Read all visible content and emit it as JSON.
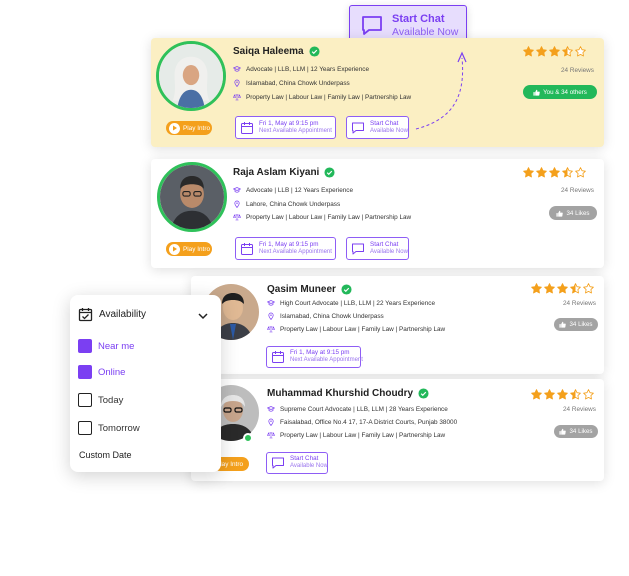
{
  "chat_callout": {
    "title": "Start Chat",
    "subtitle": "Available Now"
  },
  "lawyers": [
    {
      "name": "Saiqa Haleema",
      "qualification": "Advocate | LLB, LLM | 12 Years Experience",
      "location": "Islamabad, China Chowk Underpass",
      "practice_areas": "Property Law | Labour Law | Family Law | Partnership Law",
      "rating": 3.5,
      "reviews": "24 Reviews",
      "likes": "You & 34 others",
      "play_label": "Play Intro",
      "appointment_title": "Fri 1, May at 9:15 pm",
      "appointment_sub": "Next Available Appointment",
      "chat_title": "Start Chat",
      "chat_sub": "Available Now"
    },
    {
      "name": "Raja Aslam Kiyani",
      "qualification": "Advocate | LLB | 12 Years Experience",
      "location": "Lahore, China Chowk Underpass",
      "practice_areas": "Property Law | Labour Law | Family Law | Partnership Law",
      "rating": 3.5,
      "reviews": "24 Reviews",
      "likes": "34 Likes",
      "play_label": "Play Intro",
      "appointment_title": "Fri 1, May at 9:15 pm",
      "appointment_sub": "Next Available Appointment",
      "chat_title": "Start Chat",
      "chat_sub": "Available Now"
    },
    {
      "name": "Qasim Muneer",
      "qualification": "High Court Advocate | LLB, LLM | 22 Years Experience",
      "location": "Islamabad, China Chowk Underpass",
      "practice_areas": "Property Law | Labour Law | Family Law | Partnership Law",
      "rating": 3.5,
      "reviews": "24 Reviews",
      "likes": "34 Likes",
      "appointment_title": "Fri 1, May at 9:15 pm",
      "appointment_sub": "Next Available Appointment"
    },
    {
      "name": "Muhammad Khurshid Choudry",
      "qualification": "Supreme Court Advocate | LLB, LLM | 28 Years Experience",
      "location": "Faisalabad, Office No.4 17, 17-A District Courts, Punjab 38000",
      "practice_areas": "Property Law | Labour Law | Family Law | Partnership Law",
      "rating": 3.5,
      "reviews": "24 Reviews",
      "likes": "34 Likes",
      "play_label": "Play Intro",
      "chat_title": "Start Chat",
      "chat_sub": "Available Now"
    }
  ],
  "availability": {
    "title": "Availability",
    "options": [
      {
        "label": "Near me",
        "checked": true
      },
      {
        "label": "Online",
        "checked": true
      },
      {
        "label": "Today",
        "checked": false
      },
      {
        "label": "Tomorrow",
        "checked": false
      }
    ],
    "custom_date": "Custom Date"
  },
  "colors": {
    "accent": "#7b3ff2",
    "highlight_card": "#fbefc3",
    "star": "#f4a01c",
    "verified": "#22b85a",
    "play_button": "#f4a01c"
  }
}
